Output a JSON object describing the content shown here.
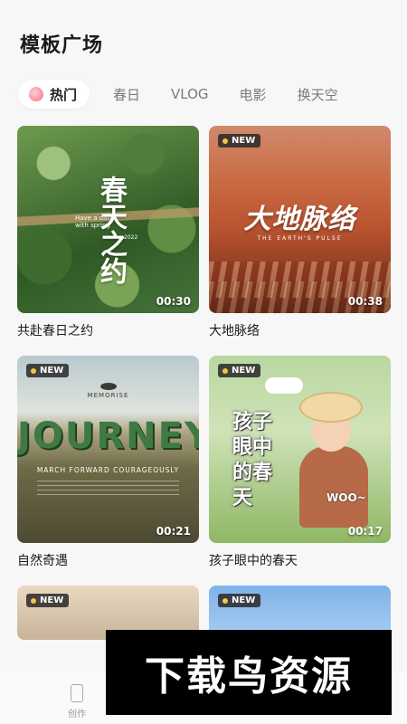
{
  "page": {
    "title": "模板广场"
  },
  "tabs": [
    {
      "label": "热门",
      "active": true,
      "icon": "peach-icon"
    },
    {
      "label": "春日"
    },
    {
      "label": "VLOG"
    },
    {
      "label": "电影"
    },
    {
      "label": "换天空"
    }
  ],
  "templates": [
    {
      "caption": "共赴春日之约",
      "duration": "00:30",
      "is_new": false,
      "overlay": {
        "main": "春天之约",
        "small": "Have a date with spring",
        "year": "2022"
      }
    },
    {
      "caption": "大地脉络",
      "duration": "00:38",
      "is_new": true,
      "overlay": {
        "main": "大地脉络",
        "small": "THE EARTH'S PULSE"
      }
    },
    {
      "caption": "自然奇遇",
      "duration": "00:21",
      "is_new": true,
      "overlay": {
        "logo": "MEMORISE",
        "main": "JOURNEY",
        "small": "MARCH FORWARD COURAGEOUSLY"
      }
    },
    {
      "caption": "孩子眼中的春天",
      "duration": "00:17",
      "is_new": true,
      "overlay": {
        "main": "孩子眼中的春天",
        "small": "WOO~"
      }
    },
    {
      "caption": "",
      "duration": "",
      "is_new": true
    },
    {
      "caption": "",
      "duration": "",
      "is_new": true
    }
  ],
  "badge": {
    "new_label": "NEW"
  },
  "bottom_nav": [
    {
      "label": "创作",
      "icon": "phone-icon"
    }
  ],
  "watermark": {
    "text": "下载鸟资源"
  },
  "colors": {
    "background": "#f7f7f7",
    "badge_dot": "#f6c344"
  }
}
